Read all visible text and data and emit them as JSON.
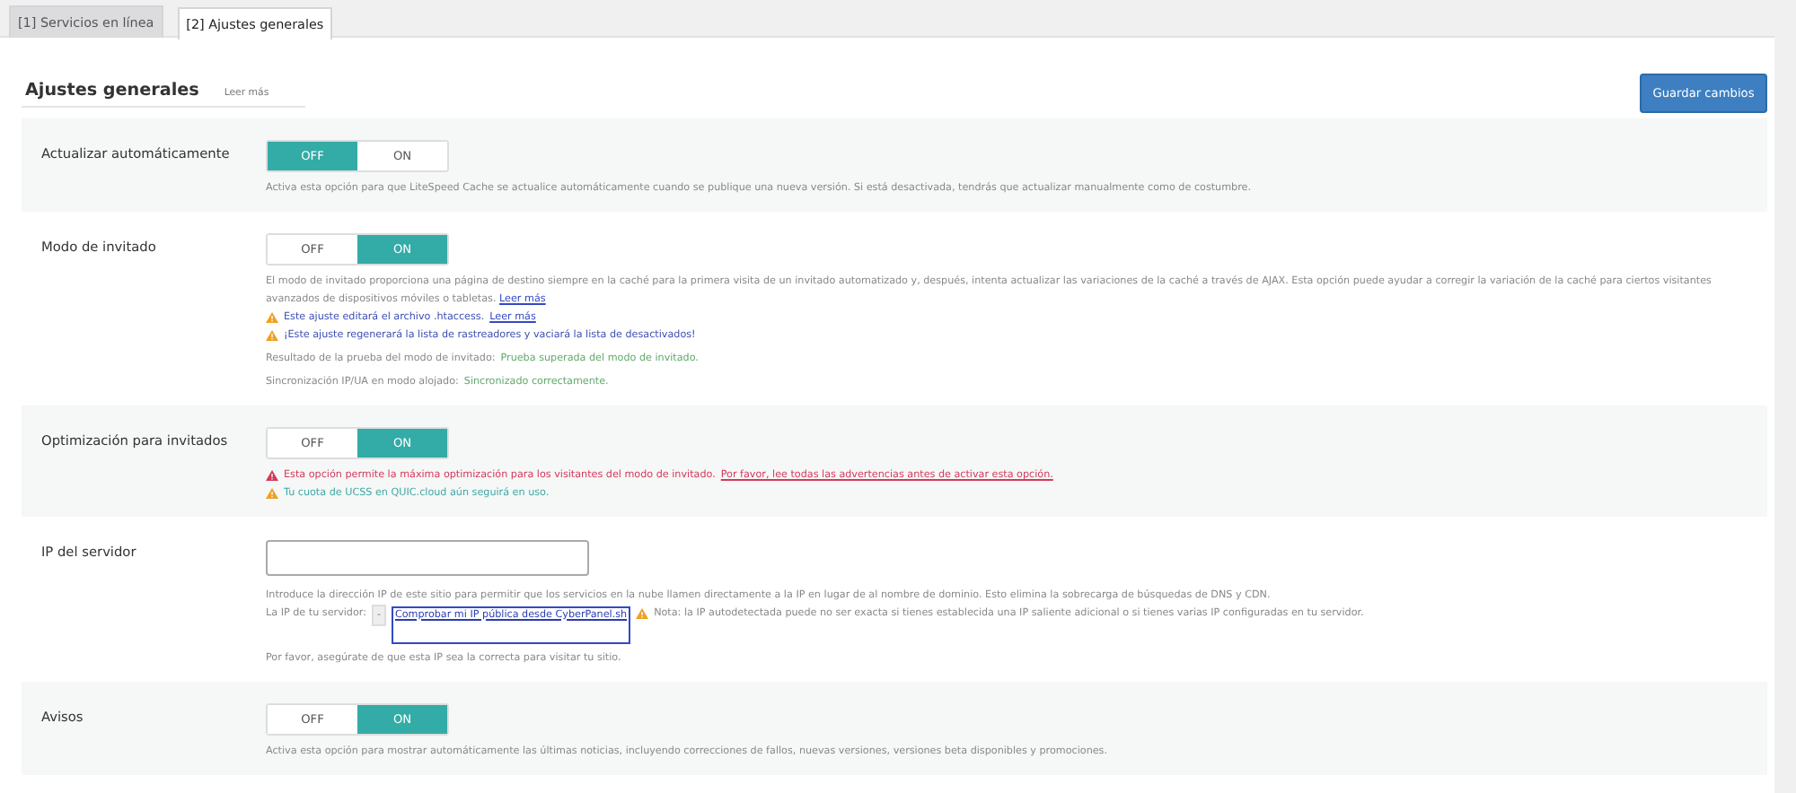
{
  "tabs": [
    {
      "label": "[1] Servicios en línea",
      "selected": false
    },
    {
      "label": "[2] Ajustes generales",
      "selected": true
    }
  ],
  "header": {
    "title": "Ajustes generales",
    "link": "Leer más",
    "save_button": "Guardar cambios"
  },
  "settings": [
    {
      "label": "Actualizar automáticamente",
      "control": {
        "kind": "toggle",
        "off_label": "OFF",
        "on_label": "ON",
        "on": false
      },
      "notes": [
        {
          "kind": "description",
          "text": "Activa esta opción para que LiteSpeed Cache se actualice automáticamente cuando se publique una nueva versión. Si está desactivada, tendrás que actualizar manualmente como de costumbre."
        }
      ]
    },
    {
      "label": "Modo de invitado",
      "control": {
        "kind": "toggle",
        "off_label": "OFF",
        "on_label": "ON",
        "on": true
      },
      "notes": [
        {
          "kind": "description",
          "text": "El modo de invitado proporciona una página de destino siempre en la caché para la primera visita de un invitado automatizado y, después, intenta actualizar las variaciones de la caché a través de AJAX. Esta opción puede ayudar a corregir la variación de la caché para ciertos visitantes avanzados de dispositivos móviles o tabletas.",
          "link": "Leer más"
        },
        {
          "kind": "warning",
          "text": "Este ajuste editará el archivo .htaccess.",
          "link": "Leer más"
        },
        {
          "kind": "warning",
          "text": "¡Este ajuste regenerará la lista de rastreadores y vaciará la lista de desactivados!"
        },
        {
          "kind": "result",
          "text": "Resultado de la prueba del modo de invitado:",
          "status": "Prueba superada del modo de invitado."
        },
        {
          "kind": "result",
          "text": "Sincronización IP/UA en modo alojado:",
          "status": "Sincronizado correctamente."
        }
      ]
    },
    {
      "label": "Optimización para invitados",
      "control": {
        "kind": "toggle",
        "off_label": "OFF",
        "on_label": "ON",
        "on": true
      },
      "notes": [
        {
          "kind": "danger",
          "text": "Esta opción permite la máxima optimización para los visitantes del modo de invitado.",
          "link": "Por favor, lee todas las advertencias antes de activar esta opción."
        },
        {
          "kind": "notice",
          "text": "Tu cuota de UCSS en QUIC.cloud aún seguirá en uso."
        }
      ]
    },
    {
      "label": "IP del servidor",
      "control": {
        "kind": "input"
      },
      "notes": [
        {
          "kind": "description",
          "text": "Introduce la dirección IP de este sitio para permitir que los servicios en la nube llamen directamente a la IP en lugar de al nombre de dominio. Esto elimina la sobrecarga de búsquedas de DNS y CDN."
        },
        {
          "kind": "ip",
          "text": "La IP de tu servidor:",
          "value": "-",
          "link": "Comprobar mi IP pública desde CyberPanel.sh",
          "note": "Nota: la IP autodetectada puede no ser exacta si tienes establecida una IP saliente adicional o si tienes varias IP configuradas en tu servidor."
        },
        {
          "kind": "result",
          "text": "Por favor, asegúrate de que esta IP sea la correcta para visitar tu sitio."
        }
      ]
    },
    {
      "label": "Avisos",
      "control": {
        "kind": "toggle",
        "off_label": "OFF",
        "on_label": "ON",
        "on": true
      },
      "notes": [
        {
          "kind": "description",
          "text": "Activa esta opción para mostrar automáticamente las últimas noticias, incluyendo correcciones de fallos, nuevas versiones, versiones beta disponibles y promociones."
        }
      ]
    }
  ]
}
